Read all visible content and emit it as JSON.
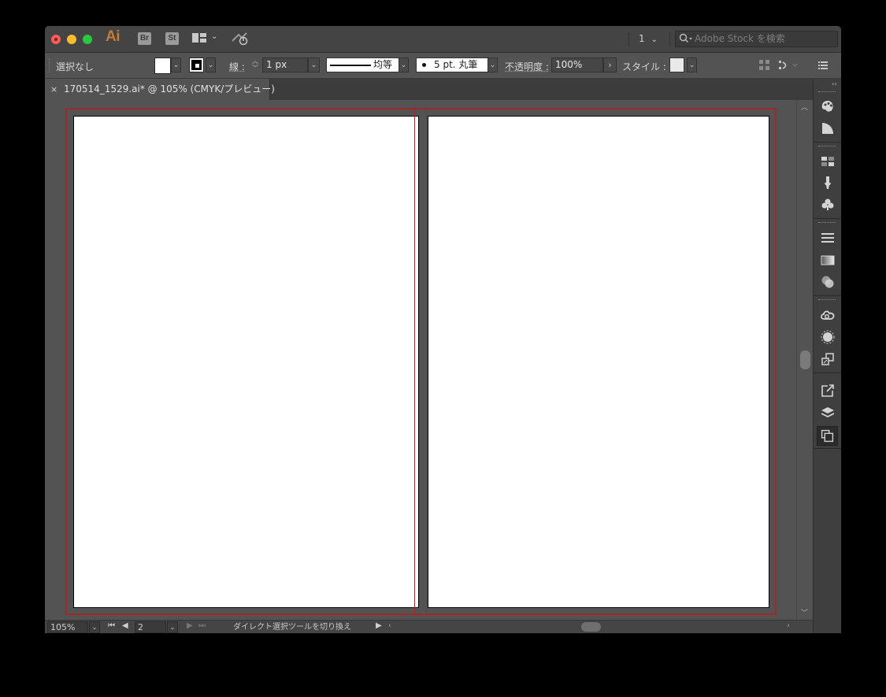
{
  "titlebar": {
    "app_logo": "Ai",
    "bridge_badge": "Br",
    "stock_badge": "St",
    "workspace_number": "1",
    "stock_search_placeholder": "Adobe Stock を検索"
  },
  "controlbar": {
    "selection_label": "選択なし",
    "stroke_label": "線 :",
    "stroke_weight": "1 px",
    "variable_width_profile": "均等",
    "brush_definition": "5 pt. 丸筆",
    "opacity_label": "不透明度 :",
    "opacity_value": "100%",
    "style_label": "スタイル :"
  },
  "document_tab": {
    "name": "170514_1529.ai* @ 105% (CMYK/プレビュー)",
    "close_glyph": "×"
  },
  "statusbar": {
    "zoom": "105%",
    "artboard_number": "2",
    "status_text": "ダイレクト選択ツールを切り換え"
  },
  "colors": {
    "bleed_guide": "#a0282b",
    "artboard_fill": "#ffffff",
    "canvas_background": "#535353",
    "app_logo": "#c47b3a"
  },
  "dock_icons": [
    "color-icon",
    "color-guide-icon",
    "swatches-icon",
    "brushes-icon",
    "symbols-icon",
    "stroke-icon",
    "gradient-icon",
    "transparency-icon",
    "cc-libraries-icon",
    "appearance-icon",
    "graphic-styles-icon",
    "export-icon",
    "layers-icon",
    "artboards-icon"
  ]
}
